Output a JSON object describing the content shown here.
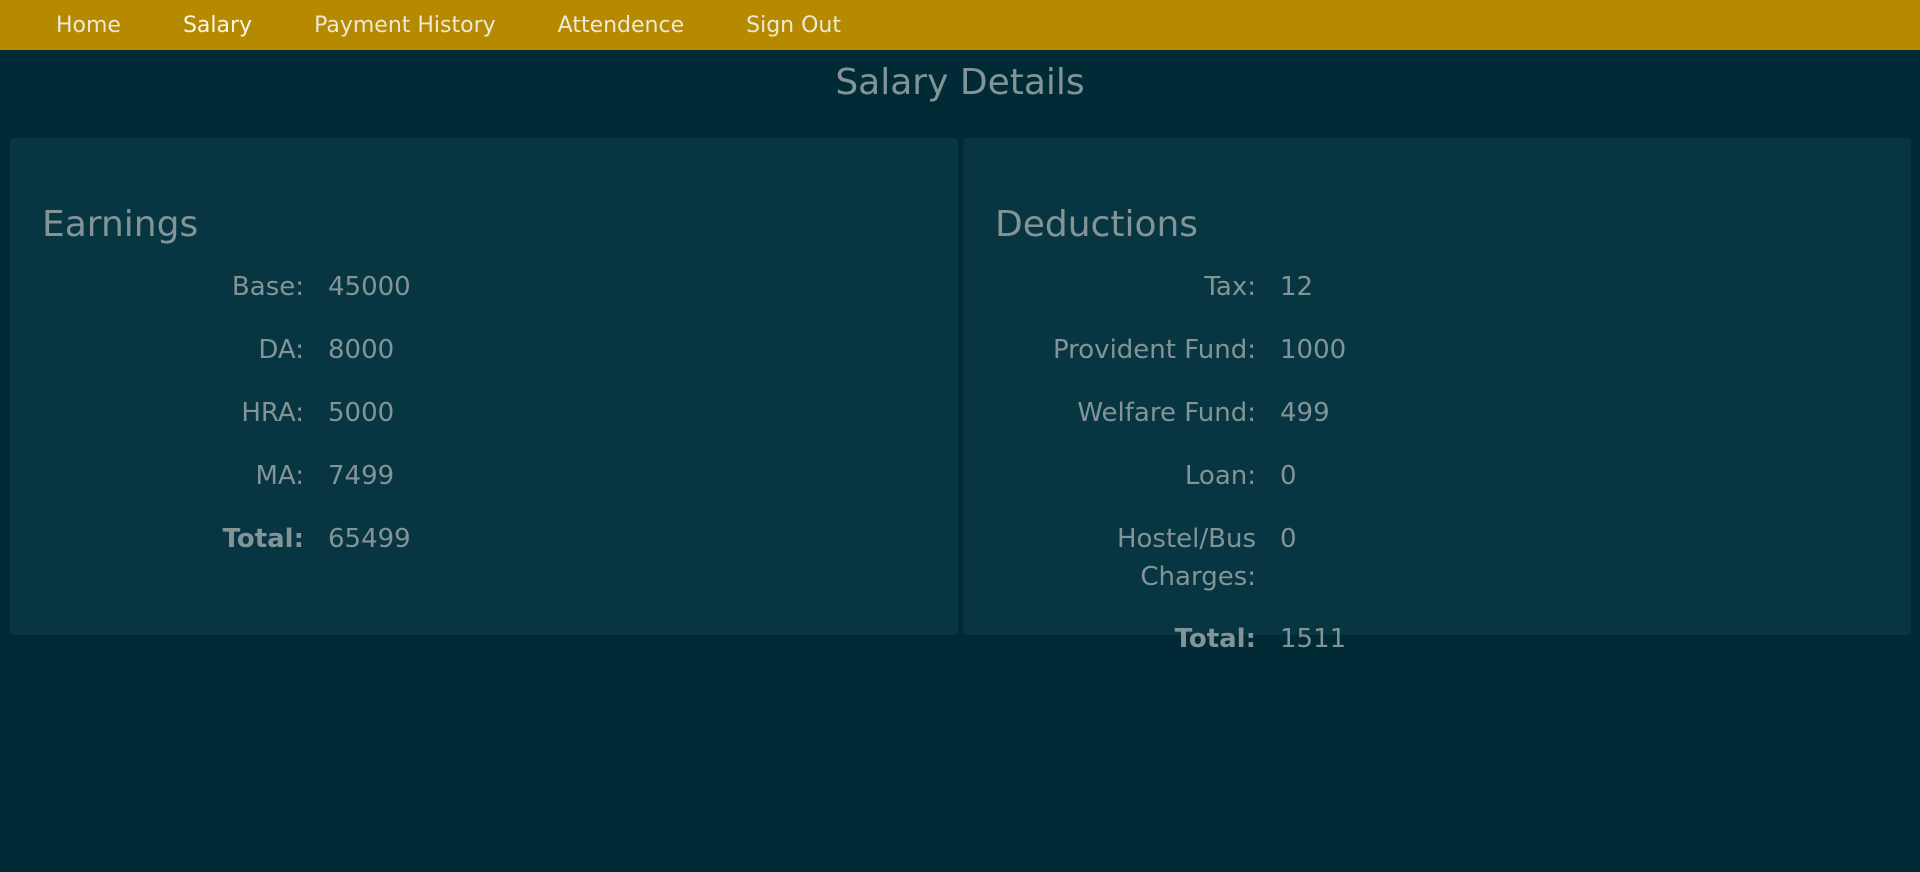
{
  "nav": {
    "items": [
      "Home",
      "Salary",
      "Payment History",
      "Attendence",
      "Sign Out"
    ],
    "active": "Salary"
  },
  "page": {
    "title": "Salary Details"
  },
  "earnings": {
    "heading": "Earnings",
    "rows": [
      {
        "label": "Base:",
        "value": "45000"
      },
      {
        "label": "DA:",
        "value": "8000"
      },
      {
        "label": "HRA:",
        "value": "5000"
      },
      {
        "label": "MA:",
        "value": "7499"
      },
      {
        "label": "Total:",
        "value": "65499"
      }
    ]
  },
  "deductions": {
    "heading": "Deductions",
    "rows": [
      {
        "label": "Tax:",
        "value": "12"
      },
      {
        "label": "Provident Fund:",
        "value": "1000"
      },
      {
        "label": "Welfare Fund:",
        "value": "499"
      },
      {
        "label": "Loan:",
        "value": "0"
      },
      {
        "label": "Hostel/Bus Charges:",
        "value": "0"
      },
      {
        "label": "Total:",
        "value": "1511"
      }
    ]
  },
  "colors": {
    "navbar": "#b58900",
    "background": "#002b36",
    "panel": "#073642",
    "text": "#839496"
  }
}
